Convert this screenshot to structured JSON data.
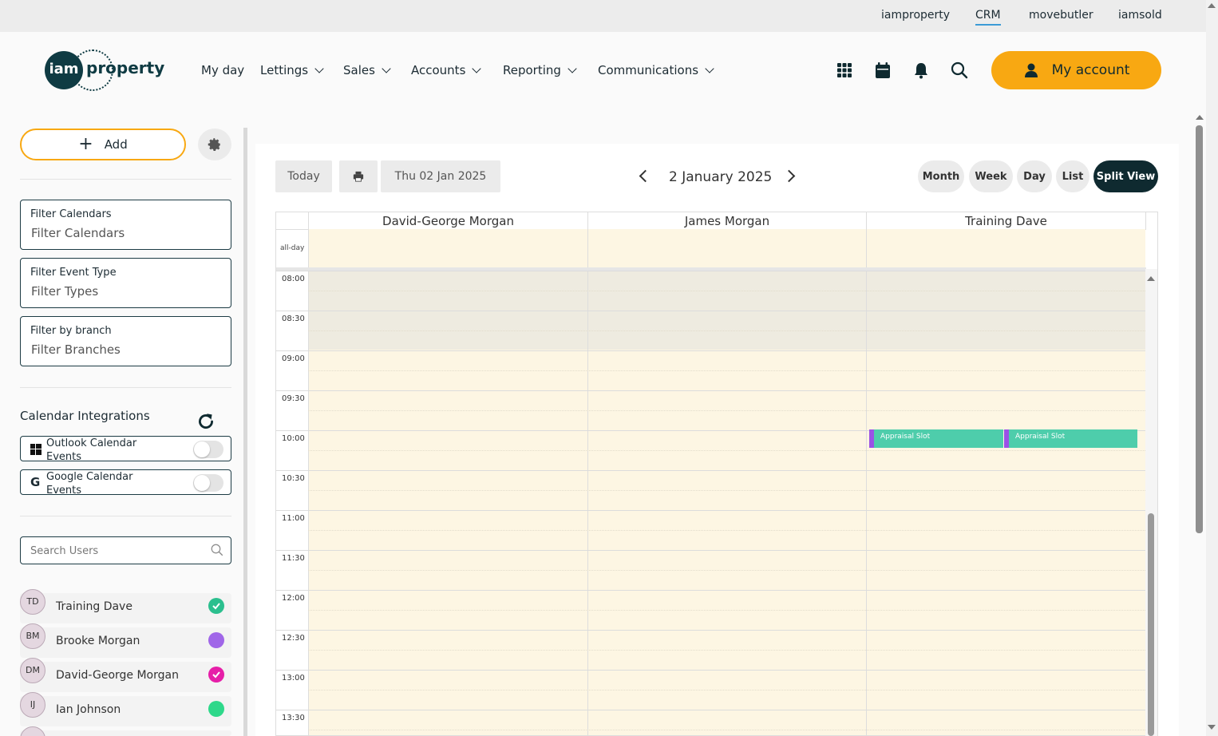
{
  "topbar": {
    "links": [
      {
        "label": "iamproperty",
        "active": false
      },
      {
        "label": "CRM",
        "active": true
      },
      {
        "label": "movebutler",
        "active": false
      },
      {
        "label": "iamsold",
        "active": false
      }
    ]
  },
  "header": {
    "logo_mark": "iam",
    "logo_word": "property",
    "nav": [
      "My day",
      "Lettings",
      "Sales",
      "Accounts",
      "Reporting",
      "Communications"
    ],
    "icons": [
      "apps-grid-icon",
      "calendar-icon",
      "bell-icon",
      "search-icon"
    ],
    "account_label": "My account",
    "accent_color": "#f8a812"
  },
  "sidebar": {
    "add_label": "Add",
    "filters": [
      {
        "label": "Filter Calendars",
        "placeholder": "Filter Calendars"
      },
      {
        "label": "Filter Event Type",
        "placeholder": "Filter Types"
      },
      {
        "label": "Filter by branch",
        "placeholder": "Filter Branches"
      }
    ],
    "integrations_title": "Calendar Integrations",
    "integrations": [
      {
        "label": "Outlook Calendar Events",
        "icon": "windows-icon",
        "enabled": false
      },
      {
        "label": "Google Calendar Events",
        "icon": "google-icon",
        "enabled": false
      }
    ],
    "search_placeholder": "Search Users",
    "users": [
      {
        "initials": "TD",
        "name": "Training Dave",
        "color": "#2bbf8e",
        "checked": true
      },
      {
        "initials": "BM",
        "name": "Brooke Morgan",
        "color": "#a066e8",
        "checked": false
      },
      {
        "initials": "DM",
        "name": "David-George Morgan",
        "color": "#e61ea8",
        "checked": true
      },
      {
        "initials": "IJ",
        "name": "Ian Johnson",
        "color": "#2ed88a",
        "checked": false
      }
    ]
  },
  "calendar": {
    "today_label": "Today",
    "date_picker_value": "Thu 02 Jan 2025",
    "title": "2 January 2025",
    "views": [
      "Month",
      "Week",
      "Day",
      "List",
      "Split View"
    ],
    "active_view": "Split View",
    "allday_label": "all-day",
    "columns": [
      "David-George Morgan",
      "James Morgan",
      "Training Dave"
    ],
    "times": [
      "08:00",
      "08:30",
      "09:00",
      "09:30",
      "10:00",
      "10:30",
      "11:00",
      "11:30",
      "12:00",
      "12:30",
      "13:00",
      "13:30"
    ],
    "events": [
      {
        "column": "Training Dave",
        "start": "10:00",
        "title": "Appraisal Slot"
      },
      {
        "column": "Training Dave",
        "start": "10:00",
        "title": "Appraisal Slot"
      }
    ]
  }
}
